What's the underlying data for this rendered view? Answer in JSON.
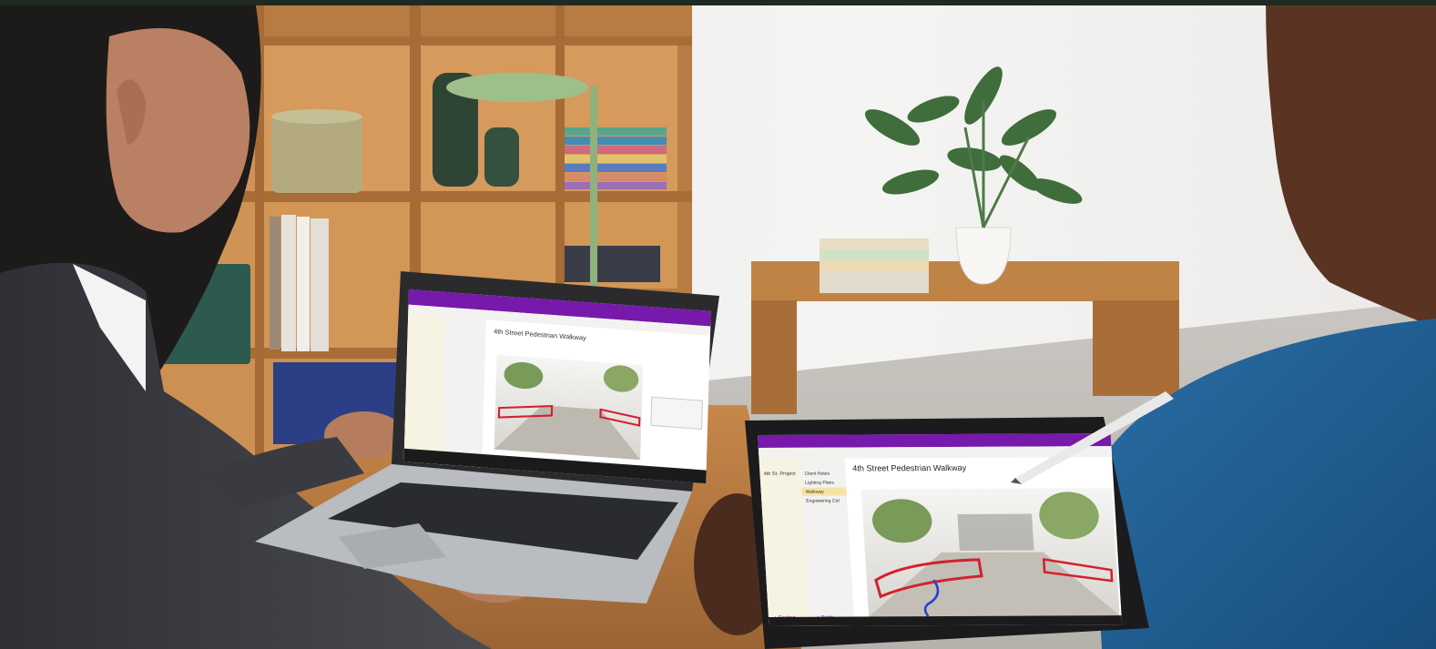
{
  "scene": {
    "kind": "photo",
    "colors": {
      "wall": "#f1f0ee",
      "shelf_wood": "#c98a4e",
      "desk_wood": "#b9793f",
      "onenote_purple": "#7719aa",
      "shirt_blue": "#1f5f94",
      "jacket_gray": "#3e3f45"
    }
  },
  "laptop_screen": {
    "page_title": "4th Street Pedestrian Walkway"
  },
  "tablet_screen": {
    "page_title": "4th Street Pedestrian Walkway",
    "section_items": [
      "4th St. Project"
    ],
    "page_items": [
      "Client Notes",
      "Lighting Plans",
      "Walkway",
      "Engineering Ctrl"
    ],
    "add_section": "+ Section",
    "add_page": "+ Page"
  }
}
